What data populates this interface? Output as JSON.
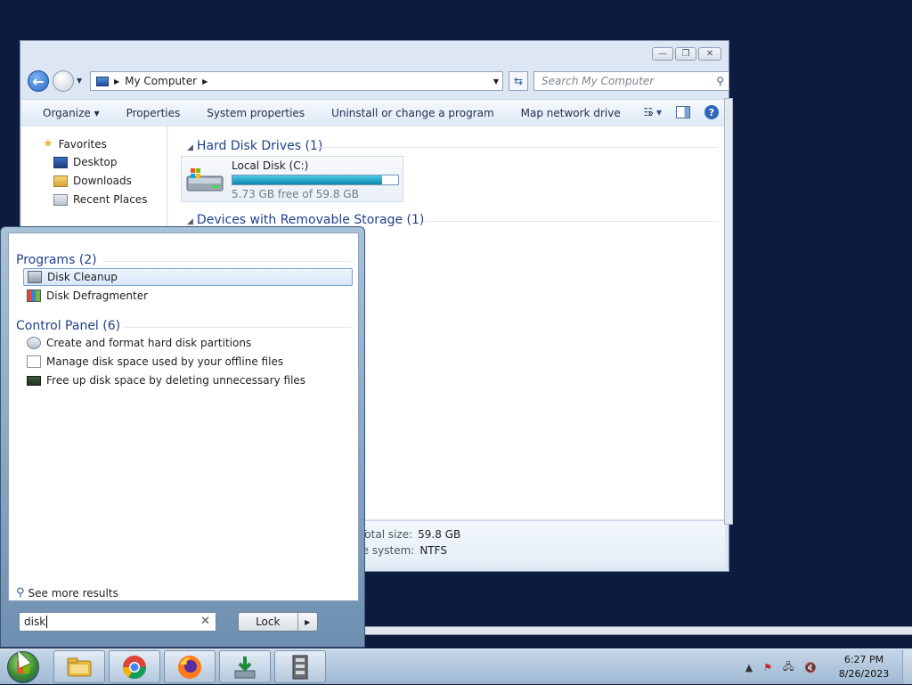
{
  "explorer": {
    "address": {
      "location": "My Computer"
    },
    "search_placeholder": "Search My Computer",
    "toolbar": {
      "organize": "Organize ▾",
      "properties": "Properties",
      "system_properties": "System properties",
      "uninstall": "Uninstall or change a program",
      "map_drive": "Map network drive",
      "more": "»"
    },
    "nav_pane": {
      "favorites": "Favorites",
      "desktop": "Desktop",
      "downloads": "Downloads",
      "recent_places": "Recent Places"
    },
    "groups": {
      "hard_disk": "Hard Disk Drives (1)",
      "removable": "Devices with Removable Storage (1)"
    },
    "drive": {
      "name": "Local Disk (C:)",
      "free_text": "5.73 GB free of 59.8 GB",
      "used_fraction": 0.904
    },
    "details": {
      "total_size_label": "Total size:",
      "total_size_value": "59.8 GB",
      "file_system_label": "File system:",
      "file_system_value": "NTFS"
    }
  },
  "start_menu": {
    "programs_header": "Programs (2)",
    "programs": [
      {
        "label": "Disk Cleanup"
      },
      {
        "label": "Disk Defragmenter"
      }
    ],
    "control_panel_header": "Control Panel (6)",
    "control_panel": [
      {
        "label": "Create and format hard disk partitions"
      },
      {
        "label": "Manage disk space used by your offline files"
      },
      {
        "label": "Free up disk space by deleting unnecessary files"
      }
    ],
    "see_more": "See more results",
    "search_value": "disk",
    "lock_label": "Lock"
  },
  "taskbar": {
    "time": "6:27 PM",
    "date": "8/26/2023"
  },
  "colors": {
    "desktop": "#0c1b3f",
    "accent": "#1e3f8a",
    "drive_bar": "#0b87ad"
  }
}
